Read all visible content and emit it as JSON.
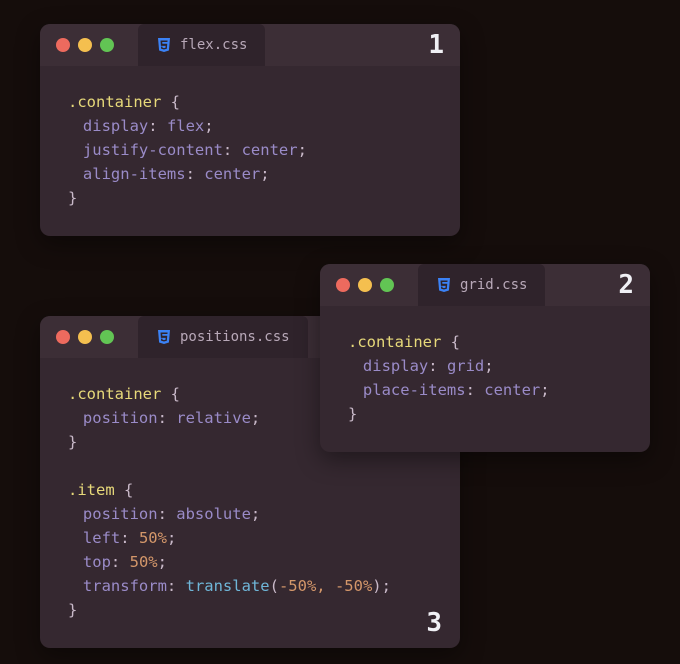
{
  "editors": {
    "flex": {
      "number": "1",
      "filename": "flex.css",
      "selector": ".container",
      "lines": [
        {
          "prop": "display",
          "value": "flex"
        },
        {
          "prop": "justify-content",
          "value": "center"
        },
        {
          "prop": "align-items",
          "value": "center"
        }
      ]
    },
    "grid": {
      "number": "2",
      "filename": "grid.css",
      "selector": ".container",
      "lines": [
        {
          "prop": "display",
          "value": "grid"
        },
        {
          "prop": "place-items",
          "value": "center"
        }
      ]
    },
    "positions": {
      "number": "3",
      "filename": "positions.css",
      "block1": {
        "selector": ".container",
        "lines": [
          {
            "prop": "position",
            "value": "relative"
          }
        ]
      },
      "block2": {
        "selector": ".item",
        "lines": [
          {
            "prop": "position",
            "value": "absolute"
          },
          {
            "prop": "left",
            "value": "50%"
          },
          {
            "prop": "top",
            "value": "50%"
          }
        ],
        "transform": {
          "prop": "transform",
          "func": "translate",
          "args": "-50%, -50%"
        }
      }
    }
  },
  "glyphs": {
    "open": "{",
    "close": "}",
    "colon": ":",
    "semi": ";",
    "lp": "(",
    "rp": ")"
  }
}
